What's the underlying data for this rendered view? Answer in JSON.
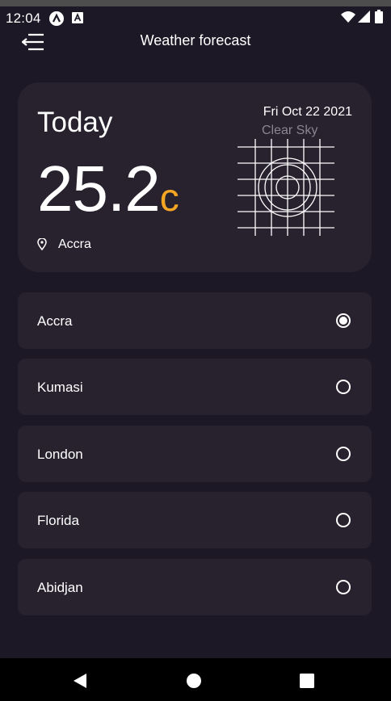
{
  "status_bar": {
    "time": "12:04",
    "left_icons": [
      "a-logo-icon",
      "a-box-icon"
    ],
    "right_icons": [
      "wifi-icon",
      "signal-icon",
      "battery-icon"
    ]
  },
  "app_bar": {
    "title": "Weather forecast",
    "menu_icon": "menu-icon"
  },
  "weather_card": {
    "today_label": "Today",
    "temperature": "25.2",
    "unit": "c",
    "date": "Fri Oct 22 2021",
    "condition": "Clear Sky",
    "weather_icon": "clear-sky-icon",
    "location": "Accra",
    "location_icon": "location-pin-icon"
  },
  "cities": [
    {
      "name": "Accra",
      "selected": true
    },
    {
      "name": "Kumasi",
      "selected": false
    },
    {
      "name": "London",
      "selected": false
    },
    {
      "name": "Florida",
      "selected": false
    },
    {
      "name": "Abidjan",
      "selected": false
    }
  ],
  "nav_bar": {
    "buttons": [
      "back-icon",
      "home-icon",
      "recents-icon"
    ]
  },
  "colors": {
    "background": "#1d1826",
    "card": "#28222f",
    "accent": "#f5a623",
    "muted": "#8a8590"
  }
}
